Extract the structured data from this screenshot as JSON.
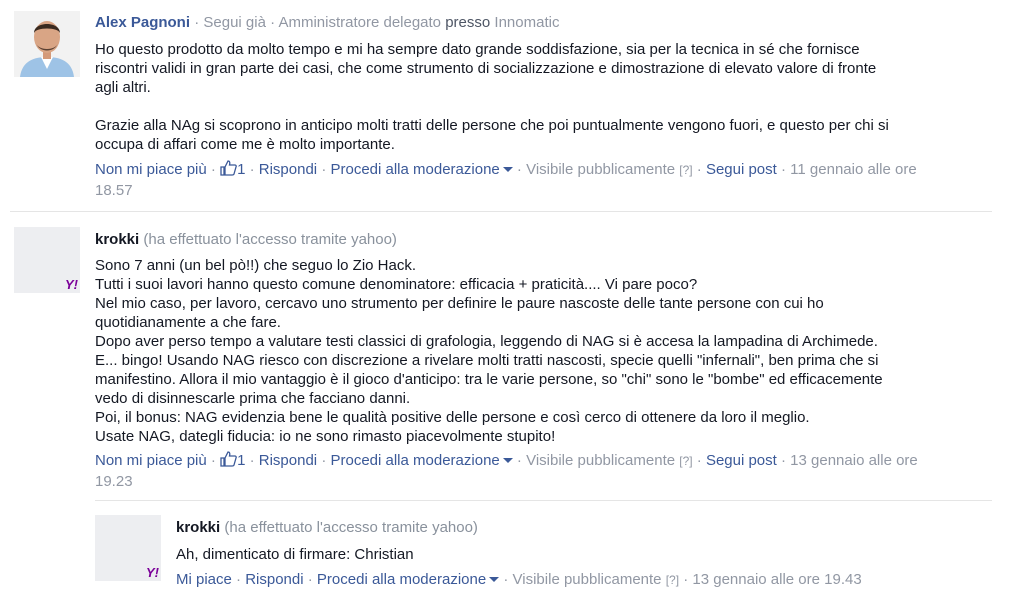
{
  "comments": [
    {
      "author": "Alex Pagnoni",
      "follow": "Segui già",
      "role_prefix": "Amministratore delegato",
      "presso": "presso",
      "company": "Innomatic",
      "lines": [
        "Ho questo prodotto da molto tempo e mi ha sempre dato grande soddisfazione, sia per la tecnica in sé che fornisce",
        "riscontri validi in gran parte dei casi, che come strumento di socializzazione e dimostrazione di elevato valore di fronte",
        "agli altri.",
        "",
        "Grazie alla NAg si scoprono in anticipo molti tratti delle persone che poi puntualmente vengono fuori, e questo per chi si",
        "occupa di affari come me è molto importante."
      ],
      "actions": {
        "like": "Non mi piace più",
        "like_count": "1",
        "reply": "Rispondi",
        "moderate": "Procedi alla moderazione",
        "visibility": "Visibile pubblicamente",
        "help": "[?]",
        "follow_post": "Segui post",
        "date_line1": "11 gennaio alle ore",
        "date_line2": "18.57"
      }
    },
    {
      "author": "krokki",
      "via": "(ha effettuato l'accesso tramite yahoo)",
      "badge": "Y!",
      "lines": [
        "Sono 7 anni (un bel pò!!) che seguo lo Zio Hack.",
        "Tutti i suoi lavori hanno questo comune denominatore: efficacia + praticità.... Vi pare poco?",
        "Nel mio caso, per lavoro, cercavo uno strumento per definire le paure nascoste delle tante persone con cui ho",
        "quotidianamente a che fare.",
        "Dopo aver perso tempo a valutare testi classici di grafologia, leggendo di NAG si è accesa la lampadina di Archimede.",
        "E... bingo! Usando NAG riesco con discrezione a rivelare molti tratti nascosti, specie quelli \"infernali\", ben prima che si",
        "manifestino. Allora il mio vantaggio è il gioco d'anticipo: tra le varie persone, so \"chi\" sono le \"bombe\" ed efficacemente",
        "vedo di disinnescarle prima che facciano danni.",
        "Poi, il bonus: NAG evidenzia bene le qualità positive delle persone e così cerco di ottenere da loro il meglio.",
        "Usate NAG, dategli fiducia: io ne sono rimasto piacevolmente stupito!"
      ],
      "actions": {
        "like": "Non mi piace più",
        "like_count": "1",
        "reply": "Rispondi",
        "moderate": "Procedi alla moderazione",
        "visibility": "Visibile pubblicamente",
        "help": "[?]",
        "follow_post": "Segui post",
        "date_line1": "13 gennaio alle ore",
        "date_line2": "19.23"
      }
    },
    {
      "author": "krokki",
      "via": "(ha effettuato l'accesso tramite yahoo)",
      "badge": "Y!",
      "lines": [
        "Ah, dimenticato di firmare: Christian"
      ],
      "actions": {
        "like": "Mi piace",
        "reply": "Rispondi",
        "moderate": "Procedi alla moderazione",
        "visibility": "Visibile pubblicamente",
        "help": "[?]",
        "date": "13 gennaio alle ore 19.43"
      }
    }
  ],
  "colors": {
    "link": "#3b5998",
    "muted": "#9197a3",
    "yahoo": "#7b0099"
  }
}
